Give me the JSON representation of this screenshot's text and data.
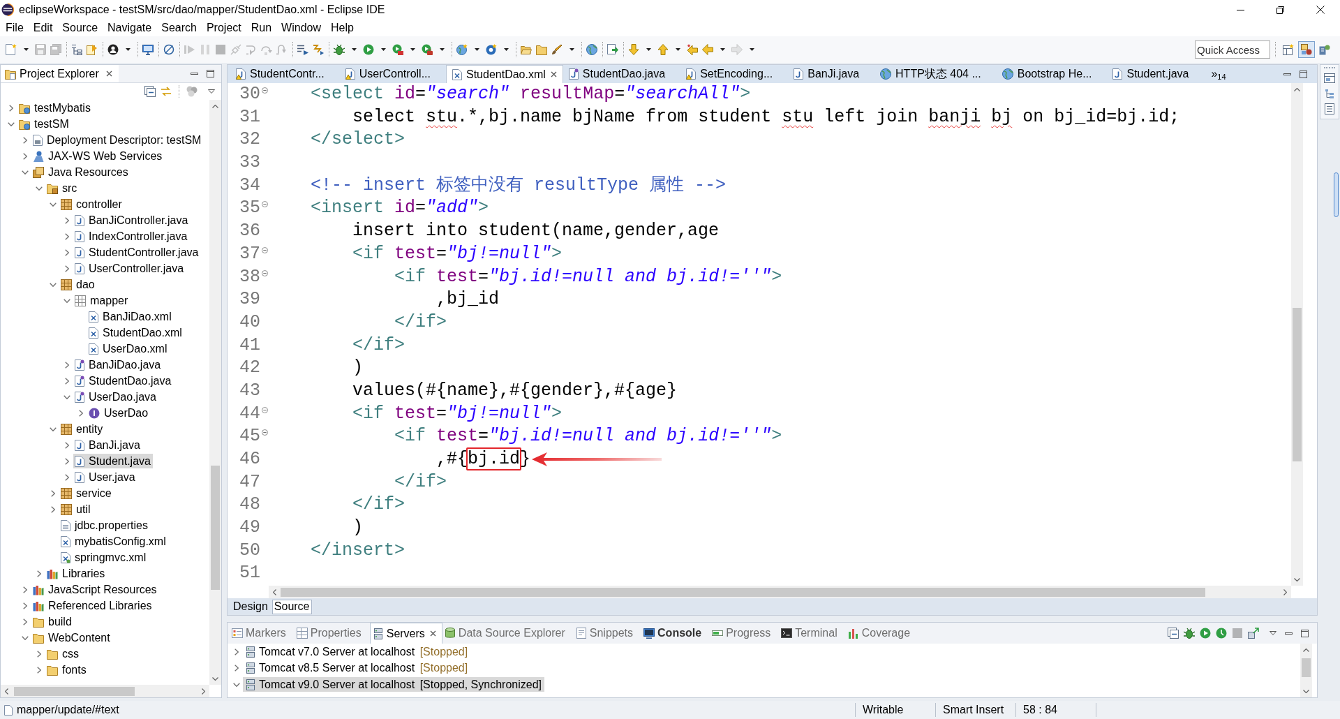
{
  "window": {
    "title": "eclipseWorkspace - testSM/src/dao/mapper/StudentDao.xml - Eclipse IDE"
  },
  "menu": [
    "File",
    "Edit",
    "Source",
    "Navigate",
    "Search",
    "Project",
    "Run",
    "Window",
    "Help"
  ],
  "toolbar": [
    {
      "kind": "new",
      "dropdown": true,
      "disabled": false
    },
    {
      "kind": "save",
      "dropdown": false,
      "disabled": true
    },
    {
      "kind": "save-all",
      "dropdown": false,
      "disabled": true
    },
    {
      "kind": "separator"
    },
    {
      "kind": "hierarchy",
      "dropdown": false,
      "disabled": false
    },
    {
      "kind": "task",
      "dropdown": false,
      "disabled": false
    },
    {
      "kind": "separator"
    },
    {
      "kind": "person",
      "dropdown": true,
      "disabled": false
    },
    {
      "kind": "separator"
    },
    {
      "kind": "monitor",
      "dropdown": false,
      "disabled": false
    },
    {
      "kind": "separator"
    },
    {
      "kind": "skip",
      "dropdown": false,
      "disabled": false
    },
    {
      "kind": "separator"
    },
    {
      "kind": "resume",
      "dropdown": false,
      "disabled": true
    },
    {
      "kind": "suspend",
      "dropdown": false,
      "disabled": true
    },
    {
      "kind": "terminate",
      "dropdown": false,
      "disabled": true
    },
    {
      "kind": "disconnect",
      "dropdown": false,
      "disabled": true
    },
    {
      "kind": "step-into",
      "dropdown": false,
      "disabled": true
    },
    {
      "kind": "step-over",
      "dropdown": false,
      "disabled": true
    },
    {
      "kind": "step-return",
      "dropdown": false,
      "disabled": true
    },
    {
      "kind": "separator"
    },
    {
      "kind": "step-filter",
      "dropdown": false,
      "disabled": false
    },
    {
      "kind": "toggle",
      "dropdown": false,
      "disabled": false
    },
    {
      "kind": "separator"
    },
    {
      "kind": "debug",
      "dropdown": true,
      "disabled": false
    },
    {
      "kind": "run",
      "dropdown": true,
      "disabled": false
    },
    {
      "kind": "coverage",
      "dropdown": true,
      "disabled": false
    },
    {
      "kind": "external",
      "dropdown": true,
      "disabled": false
    },
    {
      "kind": "separator"
    },
    {
      "kind": "new-server",
      "dropdown": true,
      "disabled": false
    },
    {
      "kind": "new-class",
      "dropdown": true,
      "disabled": false
    },
    {
      "kind": "separator"
    },
    {
      "kind": "open-folder",
      "dropdown": false,
      "disabled": false
    },
    {
      "kind": "folder",
      "dropdown": false,
      "disabled": false
    },
    {
      "kind": "brush",
      "dropdown": true,
      "disabled": false
    },
    {
      "kind": "separator"
    },
    {
      "kind": "globe",
      "dropdown": false,
      "disabled": false
    },
    {
      "kind": "separator"
    },
    {
      "kind": "launch",
      "dropdown": false,
      "disabled": false
    },
    {
      "kind": "separator"
    },
    {
      "kind": "next",
      "dropdown": true,
      "disabled": false
    },
    {
      "kind": "previous",
      "dropdown": true,
      "disabled": false
    },
    {
      "kind": "last-edit",
      "dropdown": false,
      "disabled": false
    },
    {
      "kind": "back",
      "dropdown": true,
      "disabled": false
    },
    {
      "kind": "forward",
      "dropdown": true,
      "disabled": true
    }
  ],
  "quick_access": {
    "placeholder": "Quick Access"
  },
  "perspectives": [
    {
      "kind": "open",
      "selected": false
    },
    {
      "kind": "javaee",
      "selected": true
    },
    {
      "kind": "java",
      "selected": false
    }
  ],
  "project_explorer": {
    "title": "Project Explorer",
    "tree": [
      {
        "label": "testMybatis",
        "kind": "project",
        "expanded": false,
        "selected": false
      },
      {
        "label": "testSM",
        "kind": "project",
        "expanded": true,
        "selected": false,
        "children": [
          {
            "label": "Deployment Descriptor: testSM",
            "kind": "descriptor",
            "expanded": false,
            "selected": false
          },
          {
            "label": "JAX-WS Web Services",
            "kind": "webservice",
            "expanded": false,
            "selected": false
          },
          {
            "label": "Java Resources",
            "kind": "resources",
            "expanded": true,
            "selected": false,
            "children": [
              {
                "label": "src",
                "kind": "source",
                "expanded": true,
                "selected": false,
                "children": [
                  {
                    "label": "controller",
                    "kind": "package",
                    "expanded": true,
                    "selected": false,
                    "children": [
                      {
                        "label": "BanJiController.java",
                        "kind": "java",
                        "expanded": false,
                        "selected": false
                      },
                      {
                        "label": "IndexController.java",
                        "kind": "java",
                        "expanded": false,
                        "selected": false
                      },
                      {
                        "label": "StudentController.java",
                        "kind": "java",
                        "expanded": false,
                        "selected": false
                      },
                      {
                        "label": "UserController.java",
                        "kind": "java",
                        "expanded": false,
                        "selected": false
                      }
                    ]
                  },
                  {
                    "label": "dao",
                    "kind": "package",
                    "expanded": true,
                    "selected": false,
                    "children": [
                      {
                        "label": "mapper",
                        "kind": "empty-package",
                        "expanded": true,
                        "selected": false,
                        "children": [
                          {
                            "label": "BanJiDao.xml",
                            "kind": "xml",
                            "selected": false
                          },
                          {
                            "label": "StudentDao.xml",
                            "kind": "xml",
                            "selected": false
                          },
                          {
                            "label": "UserDao.xml",
                            "kind": "xml",
                            "selected": false
                          }
                        ]
                      },
                      {
                        "label": "BanJiDao.java",
                        "kind": "java-interface",
                        "expanded": false,
                        "selected": false
                      },
                      {
                        "label": "StudentDao.java",
                        "kind": "java-interface",
                        "expanded": false,
                        "selected": false
                      },
                      {
                        "label": "UserDao.java",
                        "kind": "java-interface",
                        "expanded": true,
                        "selected": false,
                        "children": [
                          {
                            "label": "UserDao",
                            "kind": "interface",
                            "expanded": false,
                            "selected": false
                          }
                        ]
                      }
                    ]
                  },
                  {
                    "label": "entity",
                    "kind": "package",
                    "expanded": true,
                    "selected": false,
                    "children": [
                      {
                        "label": "BanJi.java",
                        "kind": "java",
                        "expanded": false,
                        "selected": false
                      },
                      {
                        "label": "Student.java",
                        "kind": "java",
                        "expanded": false,
                        "selected": true
                      },
                      {
                        "label": "User.java",
                        "kind": "java",
                        "expanded": false,
                        "selected": false
                      }
                    ]
                  },
                  {
                    "label": "service",
                    "kind": "package",
                    "expanded": false,
                    "selected": false
                  },
                  {
                    "label": "util",
                    "kind": "package",
                    "expanded": false,
                    "selected": false
                  },
                  {
                    "label": "jdbc.properties",
                    "kind": "properties",
                    "selected": false
                  },
                  {
                    "label": "mybatisConfig.xml",
                    "kind": "xml",
                    "selected": false
                  },
                  {
                    "label": "springmvc.xml",
                    "kind": "spring-xml",
                    "selected": false
                  }
                ]
              },
              {
                "label": "Libraries",
                "kind": "library",
                "expanded": false,
                "selected": false
              }
            ]
          },
          {
            "label": "JavaScript Resources",
            "kind": "library",
            "expanded": false,
            "selected": false
          },
          {
            "label": "Referenced Libraries",
            "kind": "library",
            "expanded": false,
            "selected": false
          },
          {
            "label": "build",
            "kind": "folder",
            "expanded": false,
            "selected": false
          },
          {
            "label": "WebContent",
            "kind": "folder",
            "expanded": true,
            "selected": false,
            "children": [
              {
                "label": "css",
                "kind": "folder",
                "expanded": false,
                "selected": false
              },
              {
                "label": "fonts",
                "kind": "folder",
                "expanded": false,
                "selected": false
              }
            ]
          }
        ]
      }
    ]
  },
  "editor": {
    "tabs": [
      {
        "label": "StudentContr...",
        "kind": "java-warning",
        "selected": false
      },
      {
        "label": "UserControll...",
        "kind": "java-warning",
        "selected": false
      },
      {
        "label": "StudentDao.xml",
        "kind": "xml",
        "selected": true
      },
      {
        "label": "StudentDao.java",
        "kind": "java-interface",
        "selected": false
      },
      {
        "label": "SetEncoding...",
        "kind": "java-warning",
        "selected": false
      },
      {
        "label": "BanJi.java",
        "kind": "java",
        "selected": false
      },
      {
        "label": "HTTP状态 404 ...",
        "kind": "web",
        "selected": false
      },
      {
        "label": "Bootstrap He...",
        "kind": "web",
        "selected": false
      },
      {
        "label": "Student.java",
        "kind": "java",
        "selected": false
      }
    ],
    "more_tabs": {
      "symbol": "»",
      "count": "14"
    },
    "lines": [
      {
        "number": "30",
        "fold": true,
        "tokens": [
          {
            "kind": "tag",
            "text": "    <select"
          },
          {
            "kind": "attr",
            "text": " id"
          },
          {
            "kind": "text",
            "text": "="
          },
          {
            "kind": "value",
            "text": "\"search\""
          },
          {
            "kind": "attr",
            "text": " resultMap"
          },
          {
            "kind": "text",
            "text": "="
          },
          {
            "kind": "value",
            "text": "\"searchAll\""
          },
          {
            "kind": "tag",
            "text": ">"
          }
        ]
      },
      {
        "number": "31",
        "fold": false,
        "tokens": [
          {
            "kind": "text",
            "text": "        select "
          },
          {
            "kind": "misspelled",
            "text": "stu"
          },
          {
            "kind": "text",
            "text": ".*,bj.name bjName from student "
          },
          {
            "kind": "misspelled",
            "text": "stu"
          },
          {
            "kind": "text",
            "text": " left join "
          },
          {
            "kind": "misspelled",
            "text": "banji"
          },
          {
            "kind": "misspelled",
            "text": " bj"
          },
          {
            "kind": "text",
            "text": " on bj_id=bj.id;"
          }
        ]
      },
      {
        "number": "32",
        "fold": false,
        "tokens": [
          {
            "kind": "tag",
            "text": "    </select>"
          }
        ]
      },
      {
        "number": "33",
        "fold": false
      },
      {
        "number": "34",
        "fold": false,
        "tokens": [
          {
            "kind": "comment",
            "text": "    <!-- insert 标签中没有 resultType 属性 -->"
          }
        ]
      },
      {
        "number": "35",
        "fold": true,
        "tokens": [
          {
            "kind": "tag",
            "text": "    <insert"
          },
          {
            "kind": "attr",
            "text": " id"
          },
          {
            "kind": "text",
            "text": "="
          },
          {
            "kind": "value",
            "text": "\"add\""
          },
          {
            "kind": "tag",
            "text": ">"
          }
        ]
      },
      {
        "number": "36",
        "fold": false,
        "tokens": [
          {
            "kind": "text",
            "text": "        insert into student(name,gender,age"
          }
        ]
      },
      {
        "number": "37",
        "fold": true,
        "tokens": [
          {
            "kind": "tag",
            "text": "        <if"
          },
          {
            "kind": "attr",
            "text": " test"
          },
          {
            "kind": "text",
            "text": "="
          },
          {
            "kind": "value",
            "text": "\"bj!=null\""
          },
          {
            "kind": "tag",
            "text": ">"
          }
        ]
      },
      {
        "number": "38",
        "fold": true,
        "tokens": [
          {
            "kind": "tag",
            "text": "            <if"
          },
          {
            "kind": "attr",
            "text": " test"
          },
          {
            "kind": "text",
            "text": "="
          },
          {
            "kind": "value",
            "text": "\"bj.id!=null and bj.id!=''\""
          },
          {
            "kind": "tag",
            "text": ">"
          }
        ]
      },
      {
        "number": "39",
        "fold": false,
        "tokens": [
          {
            "kind": "text",
            "text": "                ,bj_id"
          }
        ]
      },
      {
        "number": "40",
        "fold": false,
        "tokens": [
          {
            "kind": "tag",
            "text": "            </if>"
          }
        ]
      },
      {
        "number": "41",
        "fold": false,
        "tokens": [
          {
            "kind": "tag",
            "text": "        </if>"
          }
        ]
      },
      {
        "number": "42",
        "fold": false,
        "tokens": [
          {
            "kind": "text",
            "text": "        )"
          }
        ]
      },
      {
        "number": "43",
        "fold": false,
        "tokens": [
          {
            "kind": "text",
            "text": "        values(#{name},#{gender},#{age}"
          }
        ]
      },
      {
        "number": "44",
        "fold": true,
        "tokens": [
          {
            "kind": "tag",
            "text": "        <if"
          },
          {
            "kind": "attr",
            "text": " test"
          },
          {
            "kind": "text",
            "text": "="
          },
          {
            "kind": "value",
            "text": "\"bj!=null\""
          },
          {
            "kind": "tag",
            "text": ">"
          }
        ]
      },
      {
        "number": "45",
        "fold": true,
        "tokens": [
          {
            "kind": "tag",
            "text": "            <if"
          },
          {
            "kind": "attr",
            "text": " test"
          },
          {
            "kind": "text",
            "text": "="
          },
          {
            "kind": "value",
            "text": "\"bj.id!=null and bj.id!=''\""
          },
          {
            "kind": "tag",
            "text": ">"
          }
        ]
      },
      {
        "number": "46",
        "fold": false,
        "arrow": true,
        "tokens": [
          {
            "kind": "text",
            "text": "                ,#{"
          },
          {
            "kind": "boxed",
            "text": "bj.id"
          },
          {
            "kind": "text",
            "text": "}"
          }
        ]
      },
      {
        "number": "47",
        "fold": false,
        "tokens": [
          {
            "kind": "tag",
            "text": "            </if>"
          }
        ]
      },
      {
        "number": "48",
        "fold": false,
        "tokens": [
          {
            "kind": "tag",
            "text": "        </if>"
          }
        ]
      },
      {
        "number": "49",
        "fold": false,
        "tokens": [
          {
            "kind": "text",
            "text": "        )"
          }
        ]
      },
      {
        "number": "50",
        "fold": false,
        "tokens": [
          {
            "kind": "tag",
            "text": "    </insert>"
          }
        ]
      },
      {
        "number": "51",
        "fold": false
      }
    ],
    "page_tabs": [
      {
        "label": "Design",
        "selected": false
      },
      {
        "label": "Source",
        "selected": true
      }
    ]
  },
  "bottom_panel": {
    "tabs": [
      {
        "label": "Markers",
        "kind": "markers",
        "selected": false,
        "changed": false
      },
      {
        "label": "Properties",
        "kind": "properties",
        "selected": false,
        "changed": false
      },
      {
        "label": "Servers",
        "kind": "servers",
        "selected": true,
        "changed": false
      },
      {
        "label": "Data Source Explorer",
        "kind": "datasource",
        "selected": false,
        "changed": false
      },
      {
        "label": "Snippets",
        "kind": "snippets",
        "selected": false,
        "changed": false
      },
      {
        "label": "Console",
        "kind": "console",
        "selected": false,
        "changed": true
      },
      {
        "label": "Progress",
        "kind": "progress",
        "selected": false,
        "changed": false
      },
      {
        "label": "Terminal",
        "kind": "terminal",
        "selected": false,
        "changed": false
      },
      {
        "label": "Coverage",
        "kind": "coverage",
        "selected": false,
        "changed": false
      }
    ],
    "tools": [
      {
        "kind": "collapse",
        "disabled": false
      },
      {
        "kind": "debug",
        "disabled": false
      },
      {
        "kind": "run",
        "disabled": false
      },
      {
        "kind": "profile",
        "disabled": false
      },
      {
        "kind": "stop",
        "disabled": true
      },
      {
        "kind": "publish",
        "disabled": false
      }
    ],
    "servers": [
      {
        "name": "Tomcat v7.0 Server at localhost",
        "state": "[Stopped]",
        "expanded": false,
        "selected": false
      },
      {
        "name": "Tomcat v8.5 Server at localhost",
        "state": "[Stopped]",
        "expanded": false,
        "selected": false
      },
      {
        "name": "Tomcat v9.0 Server at localhost",
        "state": "[Stopped, Synchronized]",
        "expanded": true,
        "selected": true
      }
    ]
  },
  "status_bar": {
    "path": "mapper/update/#text",
    "fields": [
      "Writable",
      "Smart Insert",
      "58 : 84"
    ]
  }
}
